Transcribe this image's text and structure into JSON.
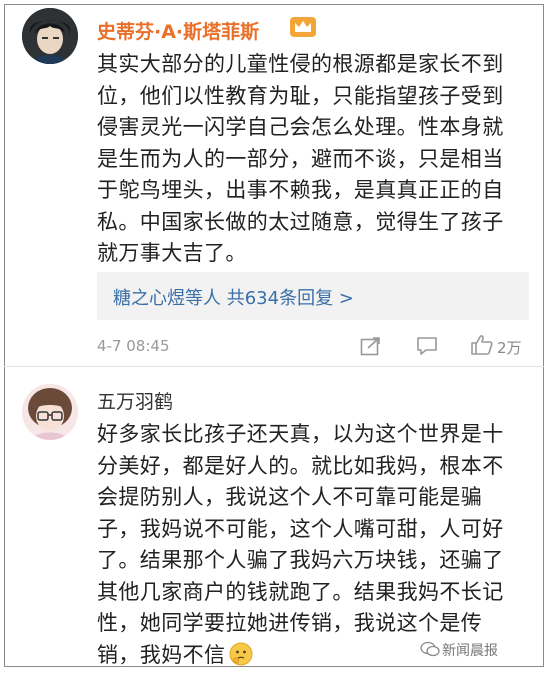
{
  "comment1": {
    "username": "史蒂芬·A·斯塔菲斯",
    "lines": [
      "其实大部分的儿童性侵的根源都是家长不到",
      "位，他们以性教育为耻，只能指望孩子受到",
      "侵害灵光一闪学自己会怎么处理。性本身就",
      "是生而为人的一部分，避而不谈，只是相当",
      "于鸵鸟埋头，出事不赖我，是真真正正的自",
      "私。中国家长做的太过随意，觉得生了孩子",
      "就万事大吉了。"
    ],
    "replies": {
      "replier": "糖之心煜",
      "middle": "等人 ",
      "count_text": "共634条回复 >"
    },
    "time": "4-7 08:45",
    "likes": "2万"
  },
  "comment2": {
    "username": "五万羽鹤",
    "lines": [
      "好多家长比孩子还天真，以为这个世界是十",
      "分美好，都是好人的。就比如我妈，根本不",
      "会提防别人，我说这个人不可靠可能是骗",
      "子，我妈说不可能，这个人嘴可甜，人可好",
      "了。结果那个人骗了我妈六万块钱，还骗了",
      "其他几家商户的钱就跑了。结果我妈不长记",
      "性，她同学要拉她进传销，我说这个是传"
    ],
    "last_line": "销，我妈不信"
  },
  "watermark": "新闻晨报",
  "icons": {
    "crown": "crown-badge-icon",
    "share": "share-icon",
    "comment": "comment-icon",
    "like": "thumbs-up-icon",
    "emoji": "thinking-face-emoji",
    "watermark": "wechat-icon"
  },
  "colors": {
    "vip_name": "#e8702a",
    "link": "#3a6fa8",
    "meta": "#999999",
    "reply_bg": "#f2f2f2"
  }
}
